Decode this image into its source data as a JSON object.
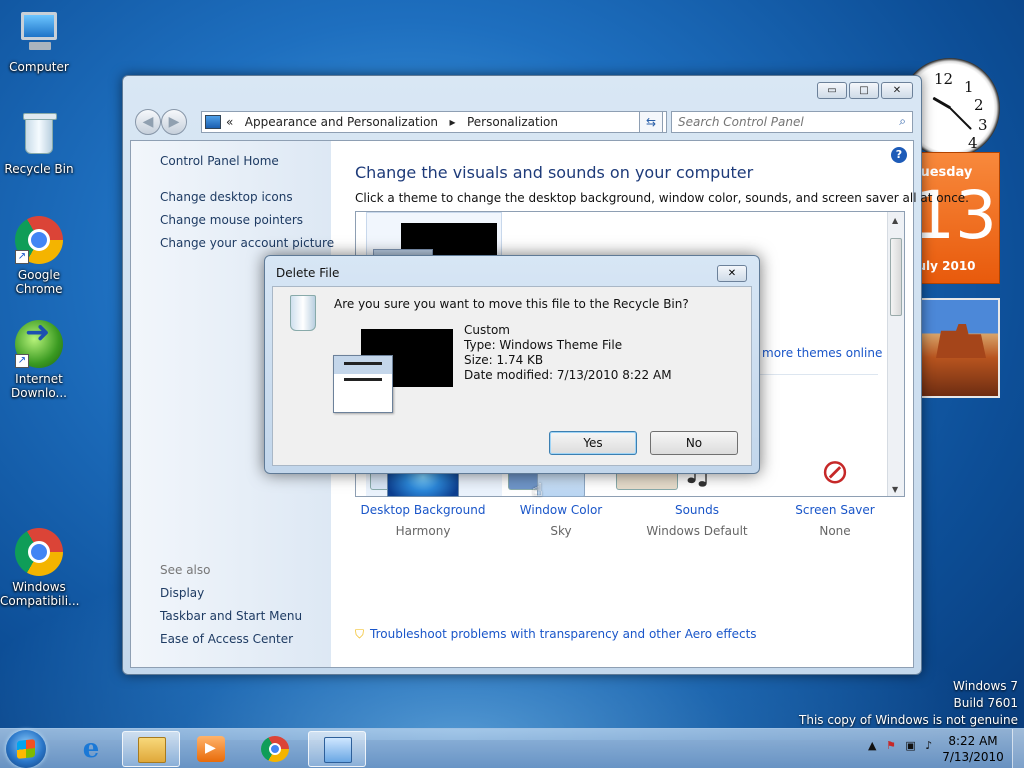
{
  "desktop": {
    "icons": [
      {
        "label": "Computer"
      },
      {
        "label": "Recycle Bin"
      },
      {
        "label": "Google Chrome"
      },
      {
        "label": "Internet Downlo..."
      },
      {
        "label": "Windows Compatibili..."
      }
    ],
    "watermark": {
      "line1": "Windows 7",
      "line2": "Build 7601",
      "line3": "This copy of Windows is not genuine"
    }
  },
  "gadgets": {
    "clock_numbers": [
      "12",
      "1",
      "2",
      "3",
      "4"
    ],
    "calendar": {
      "day": "Tuesday",
      "date": "13",
      "month": "July 2010"
    }
  },
  "window": {
    "controls": {
      "minimize": "▭",
      "maximize": "□",
      "close": "✕"
    },
    "address": {
      "prefix": "«",
      "crumb1": "Appearance and Personalization",
      "sep": "▸",
      "crumb2": "Personalization"
    },
    "search": {
      "placeholder": "Search Control Panel"
    },
    "left_pane": {
      "home": "Control Panel Home",
      "links": [
        "Change desktop icons",
        "Change mouse pointers",
        "Change your account picture"
      ],
      "see_also_title": "See also",
      "see_also": [
        "Display",
        "Taskbar and Start Menu",
        "Ease of Access Center"
      ]
    },
    "main": {
      "title": "Change the visuals and sounds on your computer",
      "description": "Click a theme to change the desktop background, window color, sounds, and screen saver all at once.",
      "more_themes": "more themes online",
      "settings": [
        {
          "name": "Desktop Background",
          "value": "Harmony"
        },
        {
          "name": "Window Color",
          "value": "Sky"
        },
        {
          "name": "Sounds",
          "value": "Windows Default"
        },
        {
          "name": "Screen Saver",
          "value": "None"
        }
      ],
      "troubleshoot": "Troubleshoot problems with transparency and other Aero effects"
    }
  },
  "dialog": {
    "title": "Delete File",
    "question": "Are you sure you want to move this file to the Recycle Bin?",
    "file": {
      "name": "Custom",
      "type": "Type: Windows Theme File",
      "size": "Size: 1.74 KB",
      "modified": "Date modified: 7/13/2010 8:22 AM"
    },
    "yes": "Yes",
    "no": "No"
  },
  "taskbar": {
    "time": "8:22 AM",
    "date": "7/13/2010"
  }
}
